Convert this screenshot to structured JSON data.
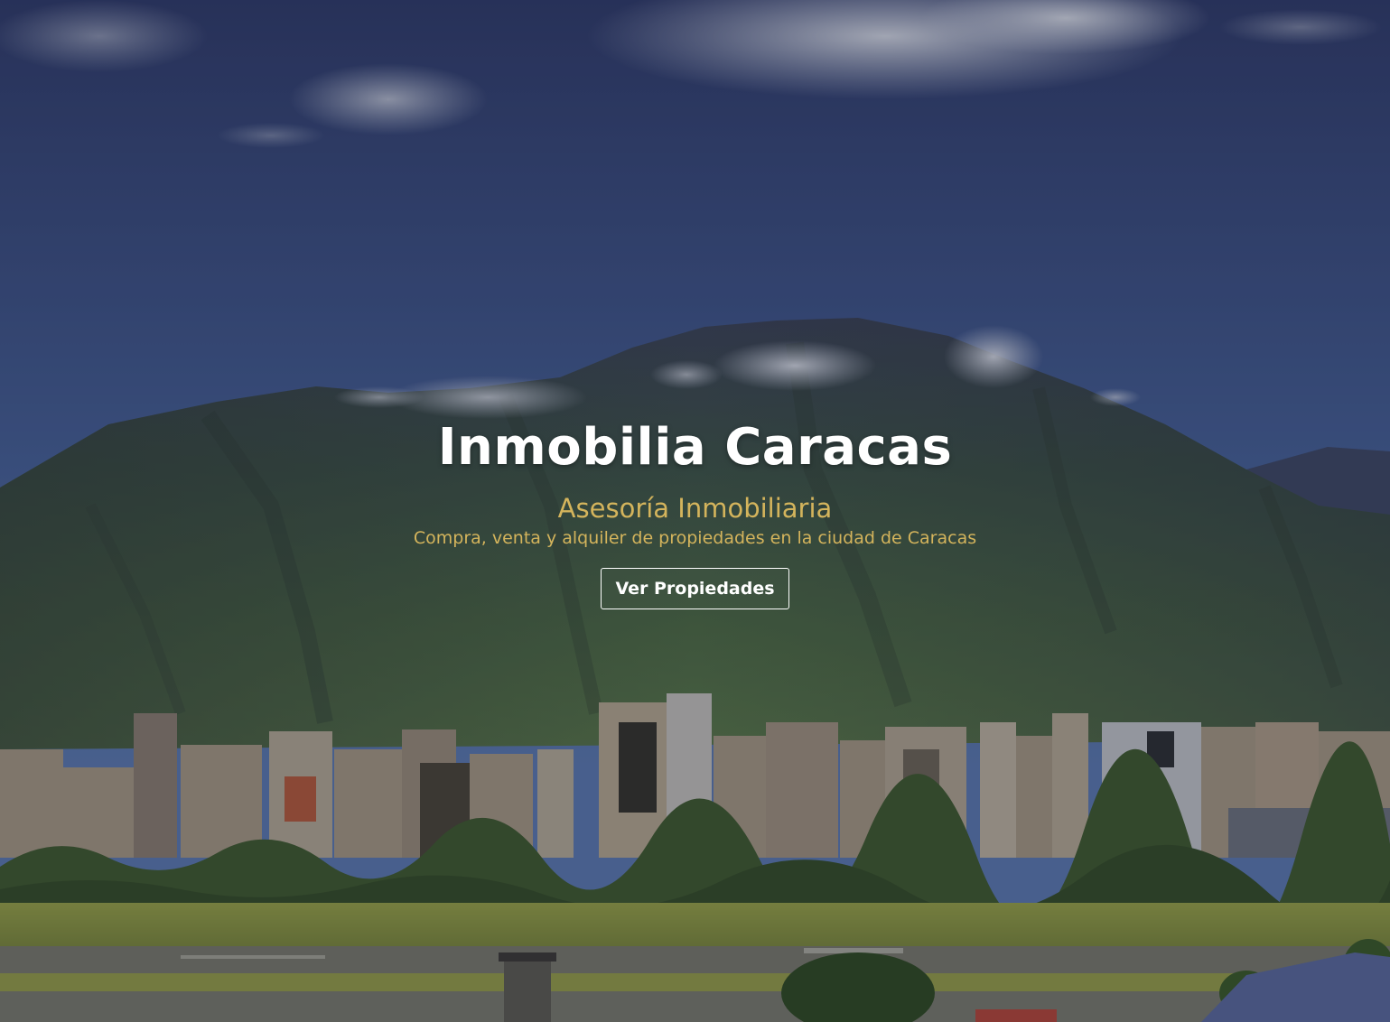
{
  "hero": {
    "title": "Inmobilia Caracas",
    "subtitle": "Asesoría Inmobiliaria",
    "tagline": "Compra, venta y alquiler de propiedades en la ciudad de Caracas",
    "cta_label": "Ver Propiedades",
    "background_image": "caracas-avila-mountain-skyline-photo"
  },
  "colors": {
    "title": "#ffffff",
    "accent": "#d4b45c",
    "button_border": "#ffffff",
    "overlay": "#141828"
  }
}
